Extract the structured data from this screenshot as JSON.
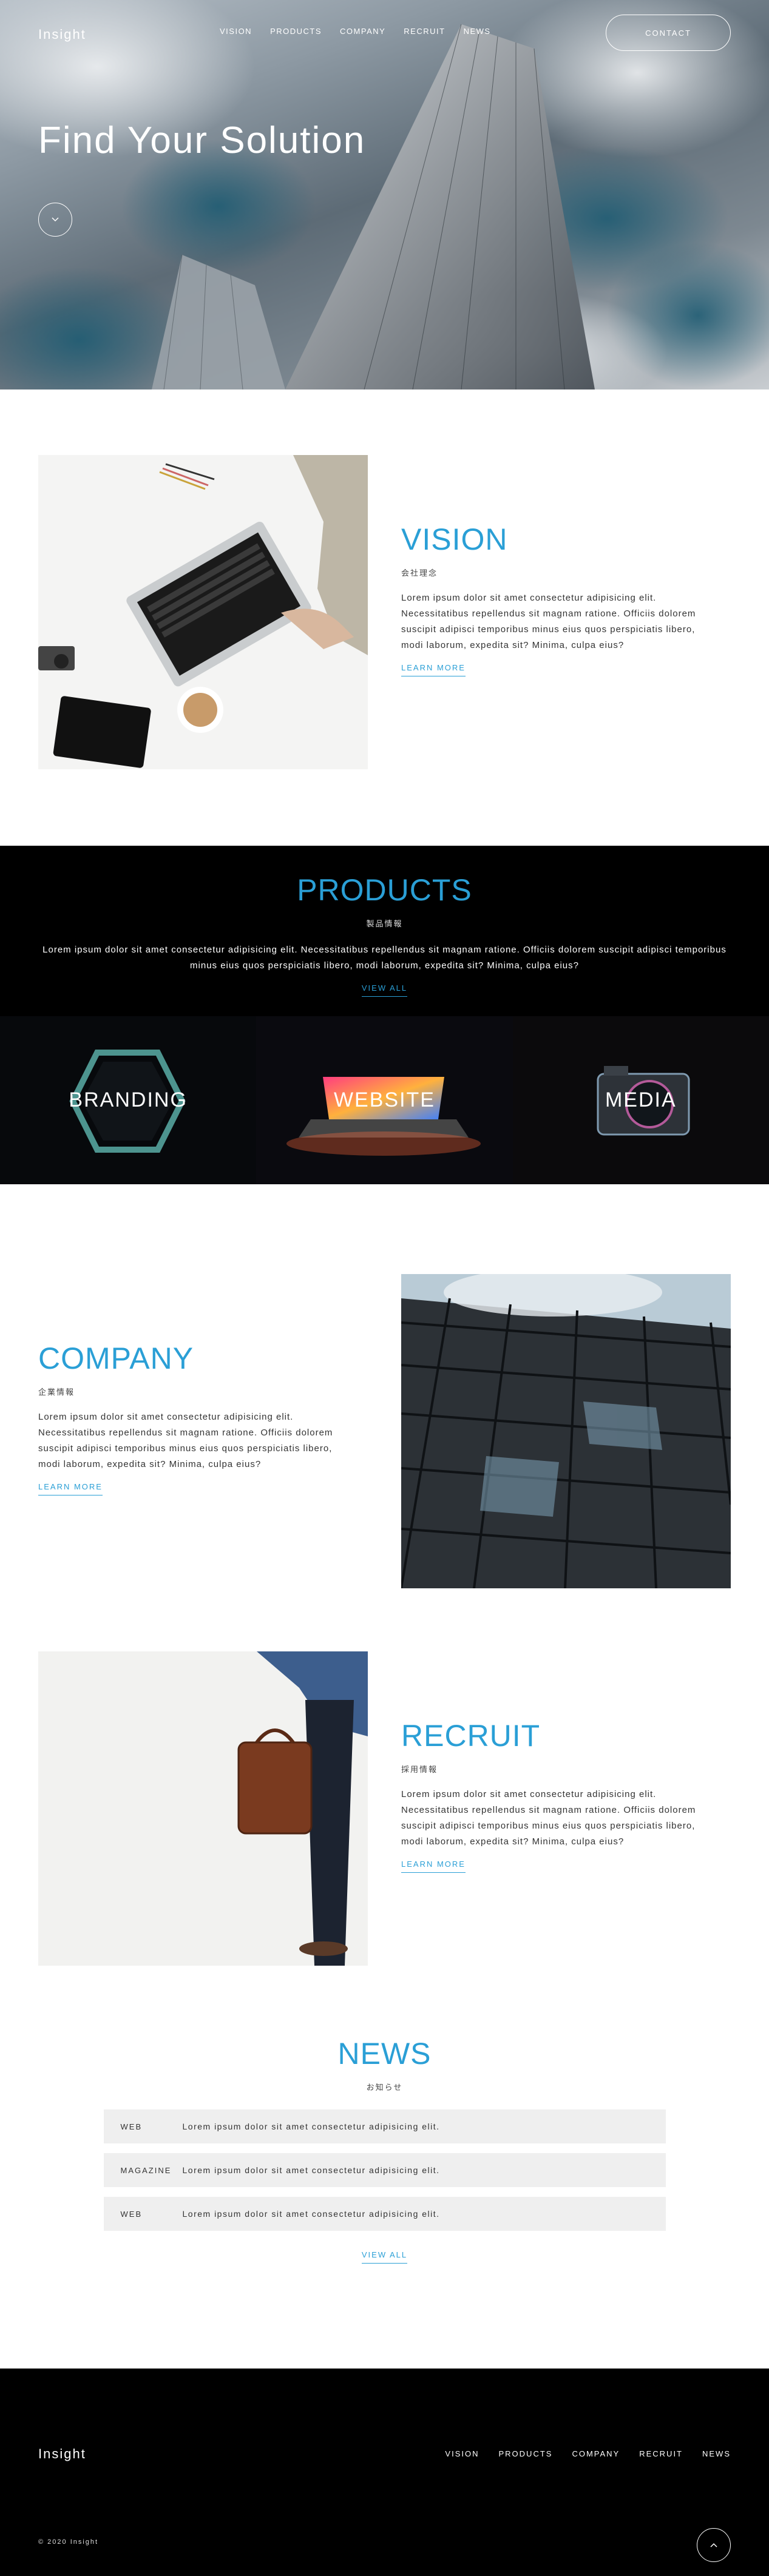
{
  "header": {
    "logo": "Insight",
    "nav": [
      "VISION",
      "PRODUCTS",
      "COMPANY",
      "RECRUIT",
      "NEWS"
    ],
    "contact_label": "CONTACT"
  },
  "hero": {
    "title": "Find Your Solution",
    "scroll_icon": "chevron-down-icon"
  },
  "vision": {
    "title": "VISION",
    "subtitle": "会社理念",
    "body": "Lorem ipsum dolor sit amet consectetur adipisicing elit. Necessitatibus repellendus sit magnam ratione. Officiis dolorem suscipit adipisci temporibus minus eius quos perspiciatis libero, modi laborum, expedita sit? Minima, culpa eius?",
    "link": "LEARN MORE"
  },
  "products": {
    "title": "PRODUCTS",
    "subtitle": "製品情報",
    "body": "Lorem ipsum dolor sit amet consectetur adipisicing elit. Necessitatibus repellendus sit magnam ratione. Officiis dolorem suscipit adipisci temporibus minus eius quos perspiciatis libero, modi laborum, expedita sit? Minima, culpa eius?",
    "link": "VIEW ALL",
    "tiles": [
      "BRANDING",
      "WEBSITE",
      "MEDIA"
    ]
  },
  "company": {
    "title": "COMPANY",
    "subtitle": "企業情報",
    "body": "Lorem ipsum dolor sit amet consectetur adipisicing elit. Necessitatibus repellendus sit magnam ratione. Officiis dolorem suscipit adipisci temporibus minus eius quos perspiciatis libero, modi laborum, expedita sit? Minima, culpa eius?",
    "link": "LEARN MORE"
  },
  "recruit": {
    "title": "RECRUIT",
    "subtitle": "採用情報",
    "body": "Lorem ipsum dolor sit amet consectetur adipisicing elit. Necessitatibus repellendus sit magnam ratione. Officiis dolorem suscipit adipisci temporibus minus eius quos perspiciatis libero, modi laborum, expedita sit? Minima, culpa eius?",
    "link": "LEARN MORE"
  },
  "news": {
    "title": "NEWS",
    "subtitle": "お知らせ",
    "items": [
      {
        "category": "WEB",
        "title": "Lorem ipsum dolor sit amet consectetur adipisicing elit."
      },
      {
        "category": "MAGAZINE",
        "title": "Lorem ipsum dolor sit amet consectetur adipisicing elit."
      },
      {
        "category": "WEB",
        "title": "Lorem ipsum dolor sit amet consectetur adipisicing elit."
      }
    ],
    "link": "VIEW ALL"
  },
  "footer": {
    "logo": "Insight",
    "nav": [
      "VISION",
      "PRODUCTS",
      "COMPANY",
      "RECRUIT",
      "NEWS"
    ],
    "copyright": "© 2020 Insight",
    "top_icon": "chevron-up-icon"
  },
  "colors": {
    "accent": "#2a9fd6",
    "dark": "#000000",
    "news_row": "#efefef"
  }
}
